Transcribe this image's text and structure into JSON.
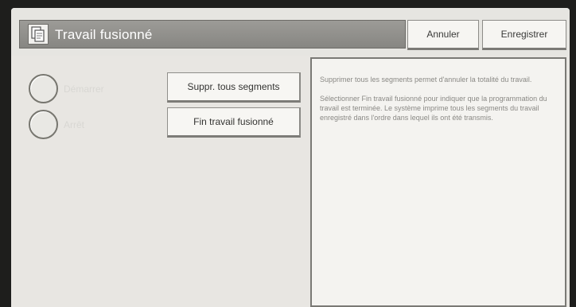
{
  "header": {
    "title": "Travail fusionné",
    "title_icon": "document-copy-icon",
    "cancel_label": "Annuler",
    "save_label": "Enregistrer"
  },
  "options": [
    {
      "label": "Démarrer"
    },
    {
      "label": "Arrêt"
    }
  ],
  "actions": {
    "delete_all_label": "Suppr. tous segments",
    "end_job_label": "Fin travail fusionné"
  },
  "info": {
    "paragraph1": "Supprimer tous les segments permet d'annuler la totalité du travail.",
    "paragraph2": "Sélectionner Fin travail fusionné pour indiquer que la programmation du travail est terminée. Le système imprime tous les segments du travail enregistré dans l'ordre dans lequel ils ont été transmis."
  }
}
